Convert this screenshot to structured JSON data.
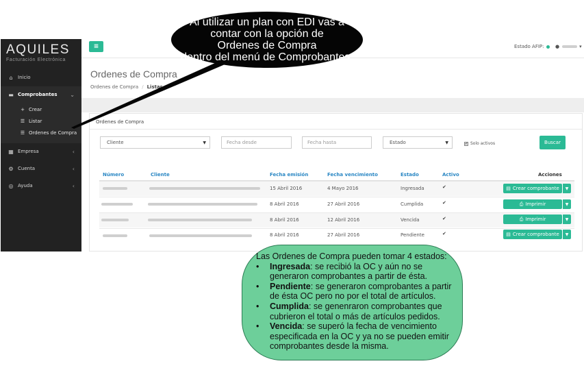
{
  "colors": {
    "accent": "#2bba95",
    "sidebar_bg": "#222222",
    "header_link": "#2a87c4",
    "callout_top_bg": "#050505",
    "callout_bottom_bg": "#6dcf9a"
  },
  "logo": {
    "name": "AQUILES",
    "tagline": "Facturación Electrónica"
  },
  "topbar": {
    "menu_icon": "hamburger-icon",
    "afip_label": "Estado AFIP:",
    "user_caret": "▾"
  },
  "sidebar": {
    "items": [
      {
        "label": "Inicio",
        "icon": "home-icon"
      },
      {
        "label": "Comprobantes",
        "icon": "receipt-icon"
      },
      {
        "label": "Empresa",
        "icon": "building-icon"
      },
      {
        "label": "Cuenta",
        "icon": "cogs-icon"
      },
      {
        "label": "Ayuda",
        "icon": "lifebuoy-icon"
      }
    ],
    "subitems": [
      {
        "label": "Crear",
        "icon": "plus-icon"
      },
      {
        "label": "Listar",
        "icon": "list-icon"
      },
      {
        "label": "Ordenes de Compra",
        "icon": "list-icon"
      }
    ]
  },
  "page": {
    "title": "Ordenes de Compra",
    "breadcrumb": [
      "Ordenes de Compra",
      "Listar"
    ]
  },
  "panel": {
    "title": "Ordenes de Compra"
  },
  "filters": {
    "client": "Cliente",
    "date_from_placeholder": "Fecha desde",
    "date_to_placeholder": "Fecha hasta",
    "state": "Estado",
    "only_active": "Solo activos",
    "search_button": "Buscar"
  },
  "table": {
    "headers": [
      "Número",
      "Cliente",
      "Fecha emisión",
      "Fecha vencimiento",
      "Estado",
      "Activo",
      "Acciones"
    ],
    "rows": [
      {
        "emision": "15 Abril 2016",
        "vencimiento": "4 Mayo 2016",
        "estado": "Ingresada",
        "activo": "✔",
        "action": "Crear comprobante"
      },
      {
        "emision": "8 Abril 2016",
        "vencimiento": "27 Abril 2016",
        "estado": "Cumplida",
        "activo": "✔",
        "action": "Imprimir"
      },
      {
        "emision": "8 Abril 2016",
        "vencimiento": "12 Abril 2016",
        "estado": "Vencida",
        "activo": "✔",
        "action": "Imprimir"
      },
      {
        "emision": "8 Abril 2016",
        "vencimiento": "27 Abril 2016",
        "estado": "Pendiente",
        "activo": "✔",
        "action": "Crear comprobante"
      }
    ]
  },
  "callout_top": {
    "lines": [
      "Al utilizar un plan con EDI vas a",
      "contar con la opción de",
      "Ordenes de Compra",
      "dentro del menú de Comprobantes."
    ]
  },
  "callout_bottom": {
    "intro": "Las Ordenes de Compra pueden tomar 4 estados:",
    "bullet": "•",
    "items": [
      {
        "term": "Ingresada",
        "text": ": se recibió la OC y aún no se generaron comprobantes a partir de ésta."
      },
      {
        "term": "Pendiente",
        "text": ": se generaron comprobantes a partir de ésta OC pero no por el total de artículos."
      },
      {
        "term": "Cumplida",
        "text": ": se genenraron comprobantes que cubrieron el total o más de artículos pedidos."
      },
      {
        "term": "Vencida",
        "text": ": se superó la fecha de vencimiento especificada en la OC y ya no se pueden emitir comprobantes desde la misma."
      }
    ]
  }
}
